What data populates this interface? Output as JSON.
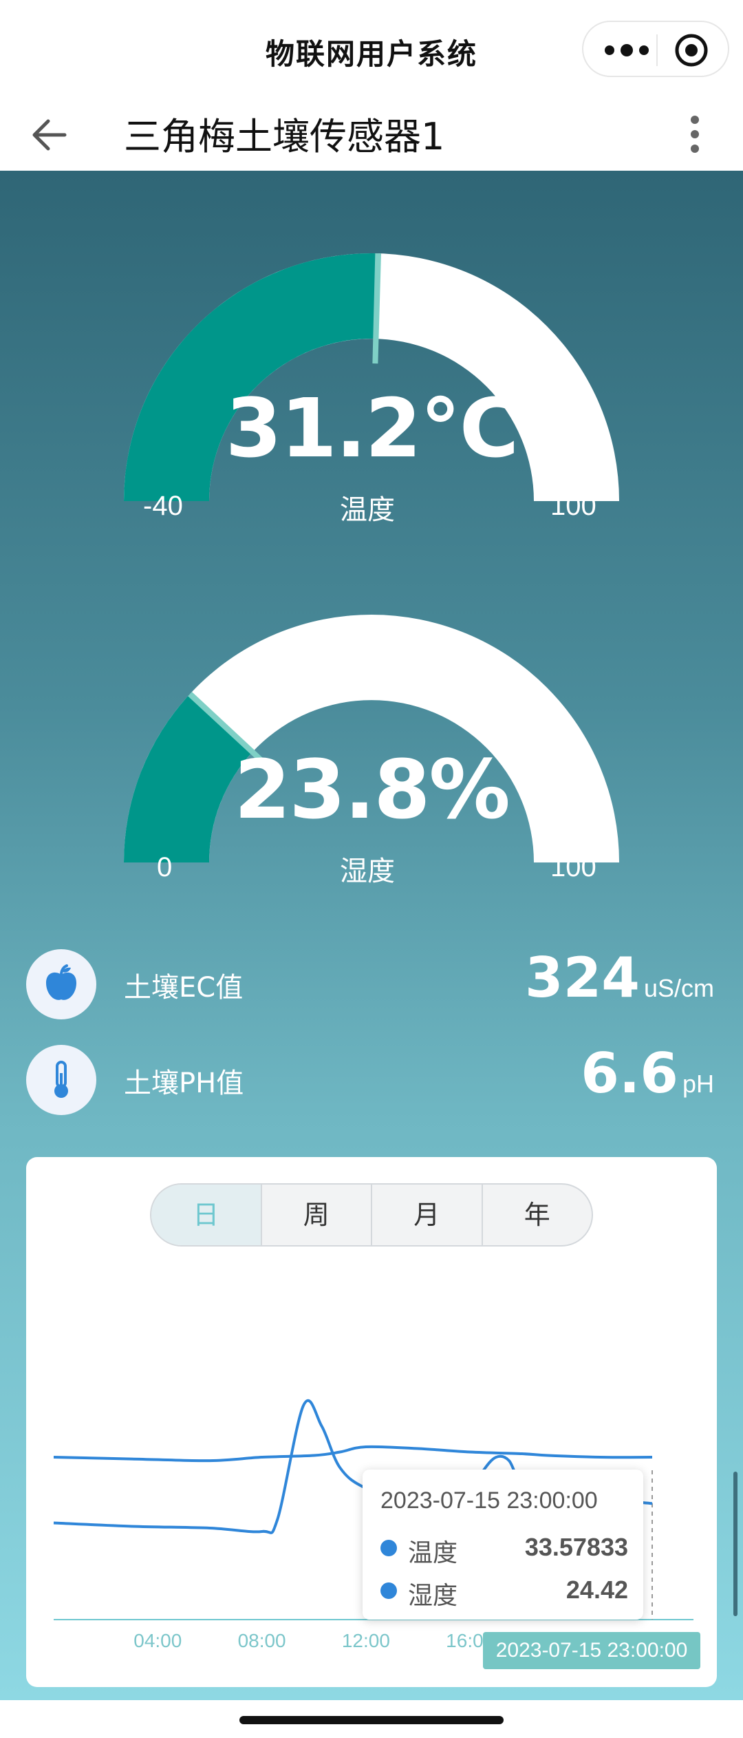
{
  "app": {
    "title": "物联网用户系统"
  },
  "nav": {
    "title": "三角梅土壤传感器1"
  },
  "gauges": [
    {
      "label": "温度",
      "value_text": "31.2°C",
      "value": 31.2,
      "min": -40,
      "max": 100,
      "min_text": "-40",
      "max_text": "100"
    },
    {
      "label": "湿度",
      "value_text": "23.8%",
      "value": 23.8,
      "min": 0,
      "max": 100,
      "min_text": "0",
      "max_text": "100"
    }
  ],
  "metrics": [
    {
      "label": "土壤EC值",
      "value": "324",
      "unit": "uS/cm",
      "icon": "apple-icon"
    },
    {
      "label": "土壤PH值",
      "value": "6.6",
      "unit": "pH",
      "icon": "thermometer-icon"
    }
  ],
  "period_tabs": [
    "日",
    "周",
    "月",
    "年"
  ],
  "active_tab": "日",
  "colors": {
    "gauge_fill": "#00968a",
    "gauge_track": "#ffffff",
    "pointer": "#7fd0c6",
    "line": "#2f86d9",
    "axis_label": "#7cc6ca"
  },
  "chart_data": {
    "type": "line",
    "x_ticks": [
      "04:00",
      "08:00",
      "12:00",
      "16:00"
    ],
    "xlim": [
      0,
      23
    ],
    "ylim": [
      0,
      100
    ],
    "series": [
      {
        "name": "温度",
        "values": [
          [
            0,
            47
          ],
          [
            3,
            46.5
          ],
          [
            6,
            46
          ],
          [
            8,
            47
          ],
          [
            10,
            47.5
          ],
          [
            11,
            48.5
          ],
          [
            12,
            50
          ],
          [
            14,
            49.5
          ],
          [
            16,
            48.5
          ],
          [
            18,
            48
          ],
          [
            19,
            47.5
          ],
          [
            21,
            47
          ],
          [
            23,
            47
          ]
        ]
      },
      {
        "name": "湿度",
        "values": [
          [
            0,
            28
          ],
          [
            3,
            27
          ],
          [
            6,
            26.5
          ],
          [
            8,
            25.5
          ],
          [
            8.6,
            29
          ],
          [
            9.6,
            62
          ],
          [
            10.3,
            56
          ],
          [
            11,
            44
          ],
          [
            12,
            38
          ],
          [
            14,
            33
          ],
          [
            15,
            31.5
          ],
          [
            16,
            36
          ],
          [
            16.5,
            43
          ],
          [
            17,
            47
          ],
          [
            17.5,
            46
          ],
          [
            18,
            39
          ],
          [
            19,
            37
          ],
          [
            21,
            35
          ],
          [
            23,
            33.6
          ]
        ]
      }
    ]
  },
  "tooltip": {
    "time": "2023-07-15 23:00:00",
    "rows": [
      {
        "name": "温度",
        "value": "33.57833"
      },
      {
        "name": "湿度",
        "value": "24.42"
      }
    ]
  },
  "axis_pointer_label": "2023-07-15 23:00:00"
}
